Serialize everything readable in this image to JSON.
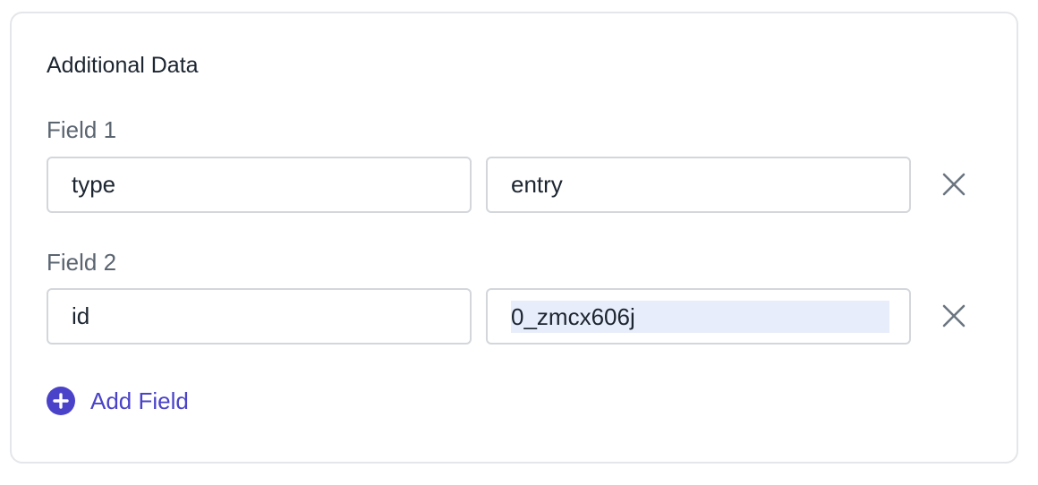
{
  "section": {
    "title": "Additional Data"
  },
  "fields": [
    {
      "label": "Field 1",
      "key": "type",
      "value": "entry"
    },
    {
      "label": "Field 2",
      "key": "id",
      "value": "0_zmcx606j"
    }
  ],
  "add_field_label": "Add Field",
  "icons": {
    "remove": "close-icon",
    "add": "plus-circle-icon"
  },
  "colors": {
    "accent": "#4a43c9",
    "selection": "#e8edfb",
    "border": "#d3d6db",
    "icon_gray": "#6b7580"
  }
}
